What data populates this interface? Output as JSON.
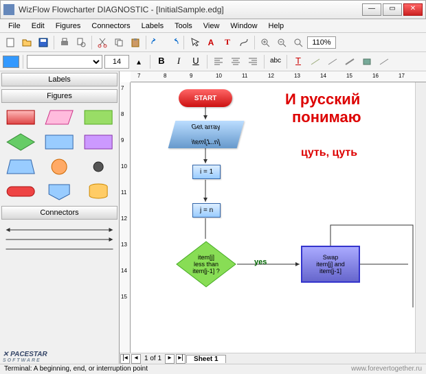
{
  "window": {
    "title": "WizFlow Flowcharter DIAGNOSTIC - [InitialSample.edg]"
  },
  "menu": [
    "File",
    "Edit",
    "Figures",
    "Connectors",
    "Labels",
    "Tools",
    "View",
    "Window",
    "Help"
  ],
  "toolbar": {
    "zoom": "110%"
  },
  "format": {
    "font_size": "14",
    "bold": "B",
    "italic": "I",
    "underline": "U",
    "abc": "abc",
    "T": "T"
  },
  "side": {
    "labels_hdr": "Labels",
    "figures_hdr": "Figures",
    "connectors_hdr": "Connectors"
  },
  "ruler_h": [
    "7",
    "8",
    "9",
    "10",
    "11",
    "12",
    "13",
    "14",
    "15",
    "16",
    "17"
  ],
  "ruler_v": [
    "7",
    "8",
    "9",
    "10",
    "11",
    "12",
    "13",
    "14",
    "15"
  ],
  "flow": {
    "start": "START",
    "getarray_l1": "Get array",
    "getarray_l2": "item[1..n]",
    "i_eq": "i = 1",
    "j_eq": "j = n",
    "dec_l1": "item[j]",
    "dec_l2": "less than",
    "dec_l3": "item[j-1] ?",
    "yes": "yes",
    "swap_l1": "Swap",
    "swap_l2": "item[j] and",
    "swap_l3": "item[j-1]",
    "red1": "И русский",
    "red2": "понимаю",
    "red3": "цуть, цуть"
  },
  "sheet": {
    "page_of": "1 of 1",
    "tab": "Sheet 1"
  },
  "status": {
    "text": "Terminal: A beginning, end, or interruption point",
    "watermark": "www.forevertogether.ru"
  },
  "brand": {
    "name": "PACESTAR",
    "sub": "SOFTWARE"
  }
}
